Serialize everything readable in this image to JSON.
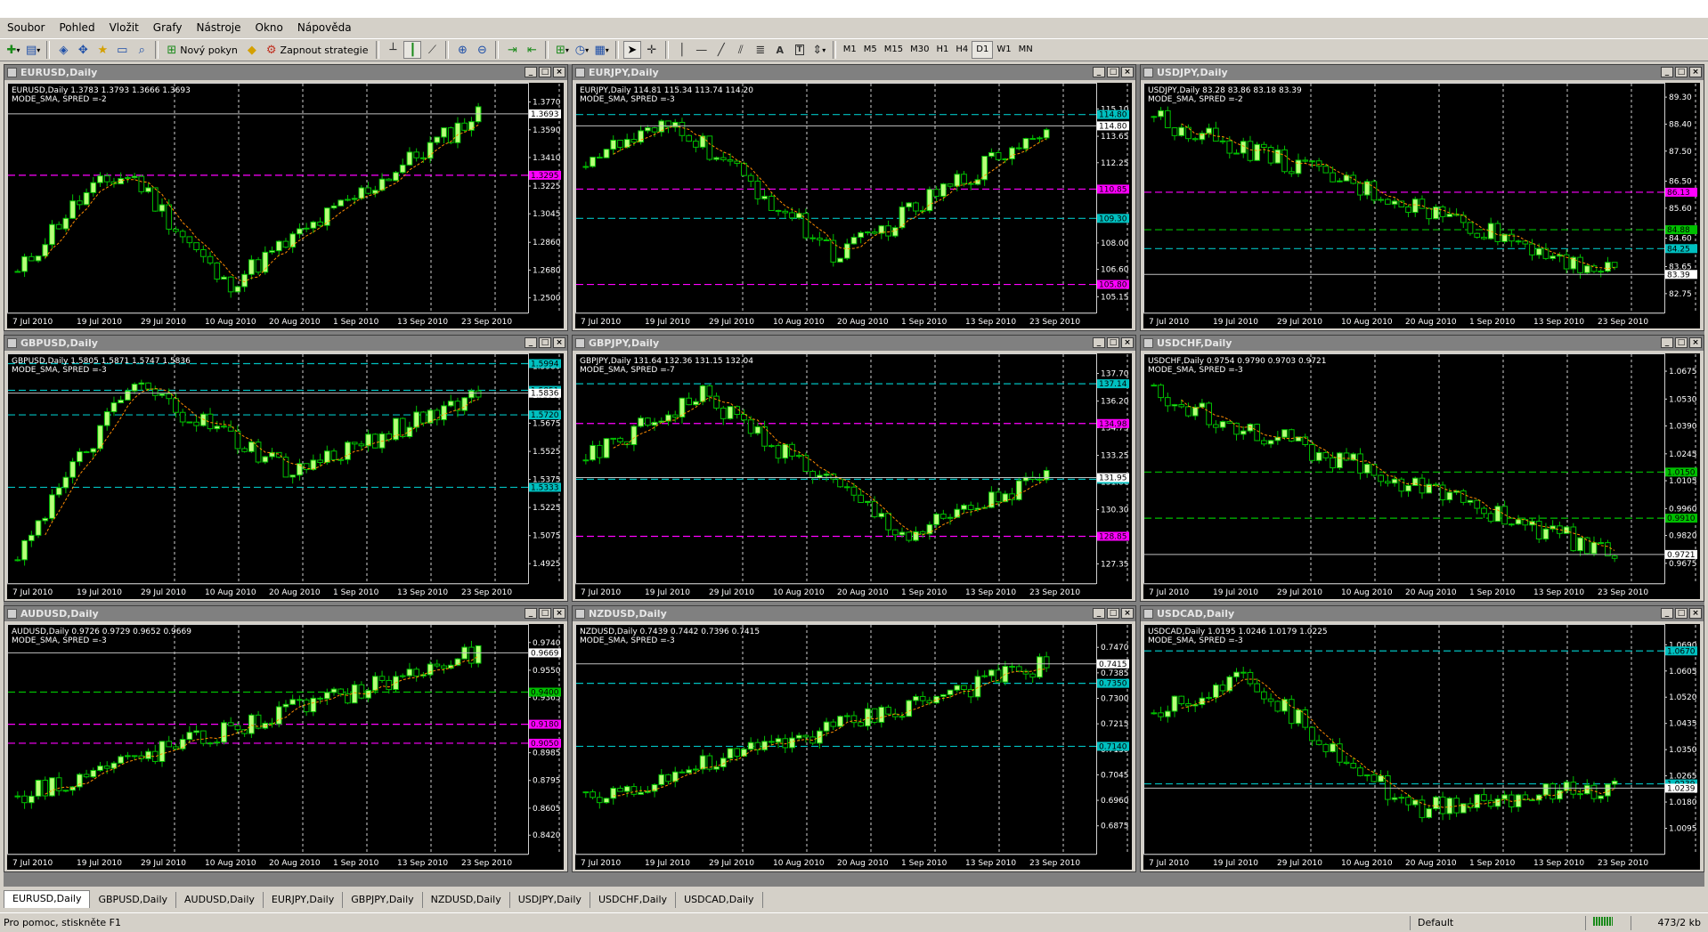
{
  "menu": [
    "Soubor",
    "Pohled",
    "Vložit",
    "Grafy",
    "Nástroje",
    "Okno",
    "Nápověda"
  ],
  "toolbar": {
    "new_order": "Nový pokyn",
    "strategies": "Zapnout strategie",
    "timeframes": [
      "M1",
      "M5",
      "M15",
      "M30",
      "H1",
      "H4",
      "D1",
      "W1",
      "MN"
    ],
    "active_timeframe": "D1"
  },
  "charts": [
    {
      "title": "EURUSD,Daily",
      "info1": "EURUSD,Daily  1.3783 1.3793 1.3666 1.3693",
      "info2": "MODE_SMA, SPRED =-2",
      "ymin": 1.244,
      "ymax": 1.386,
      "ticks": [
        "1.3770",
        "1.3590",
        "1.3410",
        "1.3225",
        "1.3045",
        "1.2860",
        "1.2680",
        "1.2500"
      ],
      "last": "1.3693",
      "close": 1.3693,
      "start": 1.265,
      "trend": "vup",
      "hlines": [
        {
          "v": 1.3295,
          "c": "#ff00ff",
          "label": "1.3295"
        }
      ]
    },
    {
      "title": "EURJPY,Daily",
      "info1": "EURJPY,Daily  114.81 115.34 113.74 114.20",
      "info2": "MODE_SMA, SPRED =-3",
      "ymin": 104.6,
      "ymax": 116.2,
      "ticks": [
        "115.10",
        "113.65",
        "112.25",
        "110.85",
        "109.30",
        "108.00",
        "106.60",
        "105.15"
      ],
      "last": "114.80",
      "close": 114.2,
      "start": 112.5,
      "trend": "dip",
      "hlines": [
        {
          "v": 114.8,
          "c": "#00c0c0",
          "label": "114.80"
        },
        {
          "v": 110.85,
          "c": "#ff00ff",
          "label": "110.85"
        },
        {
          "v": 109.3,
          "c": "#00c0c0",
          "label": "109.30"
        },
        {
          "v": 105.8,
          "c": "#ff00ff",
          "label": "105.80"
        }
      ]
    },
    {
      "title": "USDJPY,Daily",
      "info1": "USDJPY,Daily  83.28 83.86 83.18 83.39",
      "info2": "MODE_SMA, SPRED =-2",
      "ymin": 82.3,
      "ymax": 89.6,
      "ticks": [
        "89.30",
        "88.40",
        "87.50",
        "86.50",
        "85.60",
        "84.60",
        "83.65",
        "82.75"
      ],
      "last": "83.39",
      "close": 83.39,
      "start": 88.6,
      "trend": "down",
      "hlines": [
        {
          "v": 86.13,
          "c": "#ff00ff",
          "label": "86.13"
        },
        {
          "v": 84.88,
          "c": "#00c000",
          "label": "84.88"
        },
        {
          "v": 84.25,
          "c": "#00c0c0",
          "label": "84.25"
        }
      ]
    },
    {
      "title": "GBPUSD,Daily",
      "info1": "GBPUSD,Daily  1.5805 1.5871 1.5747 1.5836",
      "info2": "MODE_SMA, SPRED =-3",
      "ymin": 1.485,
      "ymax": 1.602,
      "ticks": [
        "1.5980",
        "1.5825",
        "1.5675",
        "1.5525",
        "1.5375",
        "1.5225",
        "1.5075",
        "1.4925"
      ],
      "last": "1.5836",
      "close": 1.5836,
      "start": 1.5,
      "trend": "hump",
      "hlines": [
        {
          "v": 1.5994,
          "c": "#00c0c0",
          "label": "1.5994"
        },
        {
          "v": 1.5851,
          "c": "#00c0c0",
          "label": "1.5851"
        },
        {
          "v": 1.572,
          "c": "#00c0c0",
          "label": "1.5720"
        },
        {
          "v": 1.5333,
          "c": "#00c0c0",
          "label": "1.5333"
        }
      ]
    },
    {
      "title": "GBPJPY,Daily",
      "info1": "GBPJPY,Daily  131.64 132.36 131.15 132.04",
      "info2": "MODE_SMA, SPRED =-7",
      "ymin": 126.6,
      "ymax": 138.5,
      "ticks": [
        "137.70",
        "136.20",
        "134.75",
        "133.25",
        "131.80",
        "130.30",
        "128.85",
        "127.35"
      ],
      "last": "131.95",
      "close": 132.04,
      "start": 133.0,
      "trend": "down2",
      "hlines": [
        {
          "v": 137.14,
          "c": "#00c0c0",
          "label": "137.14"
        },
        {
          "v": 134.98,
          "c": "#ff00ff",
          "label": "134.98"
        },
        {
          "v": 131.95,
          "c": "#00c0c0",
          "label": "131.95"
        },
        {
          "v": 128.85,
          "c": "#ff00ff",
          "label": "128.85"
        }
      ]
    },
    {
      "title": "USDCHF,Daily",
      "info1": "USDCHF,Daily  0.9754 0.9790 0.9703 0.9721",
      "info2": "MODE_SMA, SPRED =-3",
      "ymin": 0.96,
      "ymax": 1.074,
      "ticks": [
        "1.0675",
        "1.0530",
        "1.0390",
        "1.0245",
        "1.0105",
        "0.9960",
        "0.9820",
        "0.9675"
      ],
      "last": "0.9721",
      "close": 0.9721,
      "start": 1.055,
      "trend": "down",
      "hlines": [
        {
          "v": 1.015,
          "c": "#00c000",
          "label": "1.0150"
        },
        {
          "v": 0.991,
          "c": "#00c000",
          "label": "0.9910"
        }
      ]
    },
    {
      "title": "AUDUSD,Daily",
      "info1": "AUDUSD,Daily  0.9726 0.9729 0.9652 0.9669",
      "info2": "MODE_SMA, SPRED =-3",
      "ymin": 0.833,
      "ymax": 0.983,
      "ticks": [
        "0.9740",
        "0.9550",
        "0.9365",
        "0.9175",
        "0.8985",
        "0.8795",
        "0.8605",
        "0.8420"
      ],
      "last": "0.9669",
      "close": 0.9669,
      "start": 0.87,
      "trend": "up",
      "hlines": [
        {
          "v": 0.94,
          "c": "#00c000",
          "label": "0.9400"
        },
        {
          "v": 0.918,
          "c": "#ff00ff",
          "label": "0.9180"
        },
        {
          "v": 0.905,
          "c": "#ff00ff",
          "label": "0.9050"
        }
      ]
    },
    {
      "title": "NZDUSD,Daily",
      "info1": "NZDUSD,Daily  0.7439 0.7442 0.7396 0.7415",
      "info2": "MODE_SMA, SPRED =-3",
      "ymin": 0.68,
      "ymax": 0.753,
      "ticks": [
        "0.7470",
        "0.7385",
        "0.7300",
        "0.7215",
        "0.7130",
        "0.7045",
        "0.6960",
        "0.6875"
      ],
      "last": "0.7415",
      "close": 0.7415,
      "start": 0.696,
      "trend": "up",
      "hlines": [
        {
          "v": 0.735,
          "c": "#00c0c0",
          "label": "0.7350"
        },
        {
          "v": 0.714,
          "c": "#00c0c0",
          "label": "0.7140"
        }
      ]
    },
    {
      "title": "USDCAD,Daily",
      "info1": "USDCAD,Daily  1.0195 1.0246 1.0179 1.0225",
      "info2": "MODE_SMA, SPRED =-3",
      "ymin": 1.003,
      "ymax": 1.074,
      "ticks": [
        "1.0690",
        "1.0605",
        "1.0520",
        "1.0435",
        "1.0350",
        "1.0265",
        "1.0180",
        "1.0095"
      ],
      "last": "1.0239",
      "close": 1.0225,
      "start": 1.048,
      "trend": "dip",
      "hlines": [
        {
          "v": 1.067,
          "c": "#00c0c0",
          "label": "1.0670"
        },
        {
          "v": 1.0239,
          "c": "#00c0c0",
          "label": "1.0239"
        }
      ]
    }
  ],
  "date_labels": [
    "7 Jul 2010",
    "19 Jul 2010",
    "29 Jul 2010",
    "10 Aug 2010",
    "20 Aug 2010",
    "1 Sep 2010",
    "13 Sep 2010",
    "23 Sep 2010"
  ],
  "tabs": [
    "EURUSD,Daily",
    "GBPUSD,Daily",
    "AUDUSD,Daily",
    "EURJPY,Daily",
    "GBPJPY,Daily",
    "NZDUSD,Daily",
    "USDJPY,Daily",
    "USDCHF,Daily",
    "USDCAD,Daily"
  ],
  "active_tab": "EURUSD,Daily",
  "status": {
    "help": "Pro pomoc, stiskněte F1",
    "profile": "Default",
    "traffic": "473/2 kb"
  },
  "colors": {
    "chart_bg": "#000000",
    "candle": "#00c000",
    "candle_up": "#b8ff7a",
    "ma": "#ff8c00",
    "grid": "#cfcfcf",
    "axis_text": "#ffffff",
    "marker": "#ffc000"
  }
}
